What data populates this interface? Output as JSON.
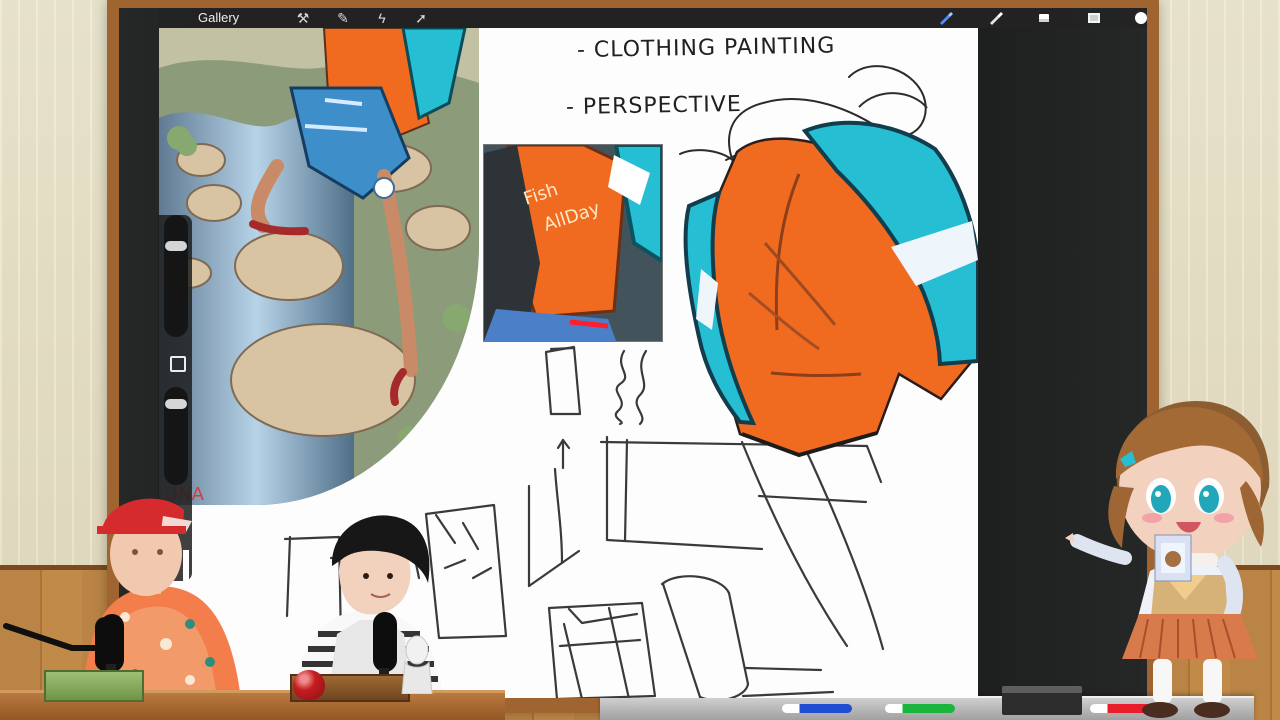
{
  "toolbar": {
    "gallery_label": "Gallery",
    "left_icons": [
      "wrench-icon",
      "magic-wand-icon",
      "selection-icon",
      "transform-icon"
    ],
    "right_icons": [
      "brush-icon",
      "smudge-icon",
      "eraser-icon",
      "layers-icon",
      "color-icon"
    ]
  },
  "canvas": {
    "notes": {
      "line_1": "- CLOTHING PAINTING",
      "line_2": "- PERSPECTIVE"
    },
    "scribble_text": "UNA"
  },
  "sidebar": {
    "brush_size_value": 0.17,
    "opacity_value": 0.08
  },
  "scene": {
    "accent_colors": {
      "shirt_orange": "#f06b20",
      "sleeve_cyan": "#26bed2",
      "board_black": "#1d1f1f",
      "wood_brown": "#a06430",
      "chalk_blue": "#1f4ed2",
      "chalk_green": "#1bb53d",
      "chalk_red": "#ea1d2a"
    }
  }
}
